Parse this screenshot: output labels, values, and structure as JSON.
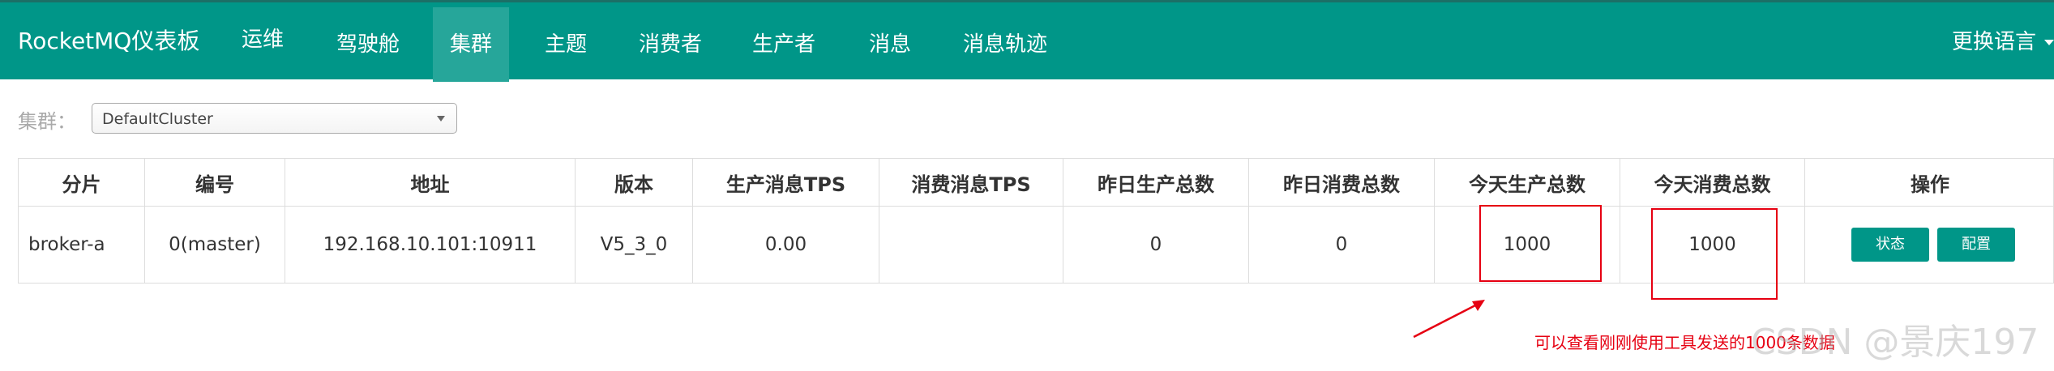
{
  "navbar": {
    "brand": "RocketMQ仪表板",
    "items": [
      {
        "label": "运维",
        "active": false
      },
      {
        "label": "驾驶舱",
        "active": false
      },
      {
        "label": "集群",
        "active": true
      },
      {
        "label": "主题",
        "active": false
      },
      {
        "label": "消费者",
        "active": false
      },
      {
        "label": "生产者",
        "active": false
      },
      {
        "label": "消息",
        "active": false
      },
      {
        "label": "消息轨迹",
        "active": false
      }
    ],
    "language_label": "更换语言"
  },
  "cluster_filter": {
    "label": "集群：",
    "selected": "DefaultCluster"
  },
  "table": {
    "headers": [
      "分片",
      "编号",
      "地址",
      "版本",
      "生产消息TPS",
      "消费消息TPS",
      "昨日生产总数",
      "昨日消费总数",
      "今天生产总数",
      "今天消费总数",
      "操作"
    ],
    "rows": [
      {
        "shard": "broker-a",
        "id": "0(master)",
        "address": "192.168.10.101:10911",
        "version": "V5_3_0",
        "produce_tps": "0.00",
        "consume_tps": "",
        "yesterday_produced": "0",
        "yesterday_consumed": "0",
        "today_produced": "1000",
        "today_consumed": "1000",
        "actions": [
          "状态",
          "配置"
        ]
      }
    ]
  },
  "annotation": {
    "text": "可以查看刚刚使用工具发送的1000条数据",
    "color": "#e60012"
  },
  "watermark": "CSDN @景庆197",
  "colors": {
    "primary": "#009688",
    "active_tab": "#26a69a"
  }
}
